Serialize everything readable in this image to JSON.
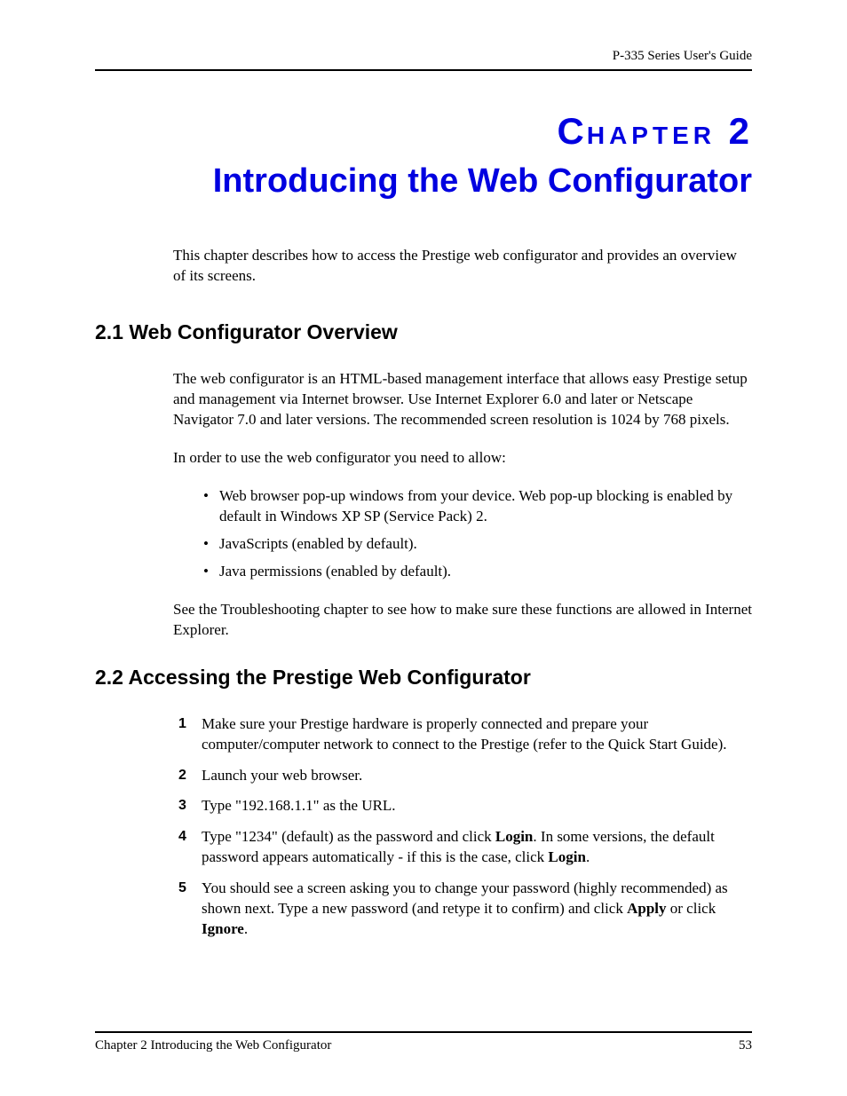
{
  "header": {
    "right": "P-335 Series User's Guide"
  },
  "chapter": {
    "label_caps_first": "C",
    "label_small_1": "HAPTER",
    "label_number": " 2",
    "subtitle": "Introducing the Web Configurator"
  },
  "intro": "This chapter describes how to access the Prestige web configurator and provides an overview of its screens.",
  "section1": {
    "heading": "2.1  Web Configurator Overview",
    "p1": "The web configurator is an HTML-based management interface that allows easy Prestige setup and management via Internet browser. Use Internet Explorer 6.0 and later or Netscape Navigator 7.0 and later versions. The recommended screen resolution is 1024 by 768 pixels.",
    "p2": "In order to use the web configurator you need to allow:",
    "bullets": [
      "Web browser pop-up windows from your device. Web pop-up blocking is enabled by default in Windows XP SP (Service Pack) 2.",
      "JavaScripts (enabled by default).",
      "Java permissions (enabled by default)."
    ],
    "p3": "See the Troubleshooting chapter to see how to make sure these functions are allowed in Internet Explorer."
  },
  "section2": {
    "heading": "2.2  Accessing the Prestige Web Configurator",
    "steps": {
      "s1": "Make sure your Prestige hardware is properly connected and prepare your computer/computer network to connect to the Prestige (refer to the Quick Start Guide).",
      "s2": "Launch your web browser.",
      "s3": "Type \"192.168.1.1\" as the URL.",
      "s4_a": "Type \"1234\" (default) as the password and click ",
      "s4_b1": "Login",
      "s4_c": ". In some versions, the default password appears automatically - if this is the case, click ",
      "s4_b2": "Login",
      "s4_d": ".",
      "s5_a": "You should see a screen asking you to change your password (highly recommended) as shown next. Type a new password (and retype it to confirm) and click ",
      "s5_b1": "Apply",
      "s5_c": " or click ",
      "s5_b2": "Ignore",
      "s5_d": "."
    }
  },
  "footer": {
    "left": "Chapter 2 Introducing the Web Configurator",
    "right": "53"
  }
}
